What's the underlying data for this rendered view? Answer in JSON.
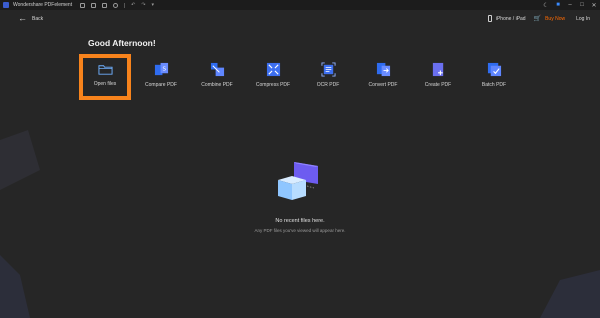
{
  "app": {
    "title": "Wondershare PDFelement"
  },
  "topbar": {
    "back_label": "Back",
    "device_label": "iPhone / iPad",
    "buy_now_label": "Buy Now",
    "login_label": "Log In"
  },
  "greeting": "Good Afternoon!",
  "tools": [
    {
      "label": "Open files",
      "icon": "folder-icon"
    },
    {
      "label": "Compare PDF",
      "icon": "compare-icon"
    },
    {
      "label": "Combine PDF",
      "icon": "combine-icon"
    },
    {
      "label": "Compress PDF",
      "icon": "compress-icon"
    },
    {
      "label": "OCR PDF",
      "icon": "ocr-icon"
    },
    {
      "label": "Convert PDF",
      "icon": "convert-icon"
    },
    {
      "label": "Create PDF",
      "icon": "create-icon"
    },
    {
      "label": "Batch PDF",
      "icon": "batch-icon"
    }
  ],
  "empty_state": {
    "title": "No recent files here.",
    "subtitle": "Any PDF files you've viewed will appear here."
  },
  "colors": {
    "highlight": "#f7831c",
    "accent": "#ff6a00",
    "background": "#262626"
  }
}
